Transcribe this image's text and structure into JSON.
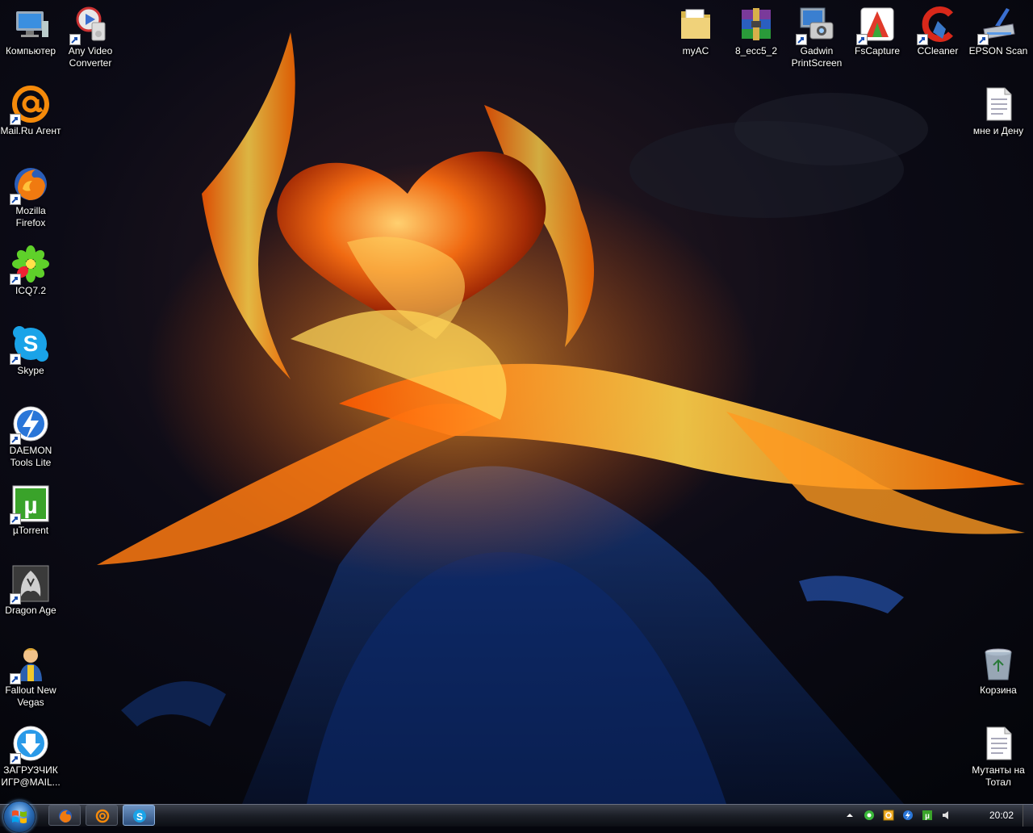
{
  "desktop": {
    "left_icons": [
      {
        "name": "computer-icon",
        "label": "Компьютер"
      },
      {
        "name": "any-video-converter-icon",
        "label": "Any Video Converter"
      },
      {
        "name": "mail-ru-agent-icon",
        "label": "Mail.Ru Агент"
      },
      {
        "name": "mozilla-firefox-icon",
        "label": "Mozilla Firefox"
      },
      {
        "name": "icq-icon",
        "label": "ICQ7.2"
      },
      {
        "name": "skype-icon",
        "label": "Skype"
      },
      {
        "name": "daemon-tools-icon",
        "label": "DAEMON Tools Lite"
      },
      {
        "name": "utorrent-icon",
        "label": "µTorrent"
      },
      {
        "name": "dragon-age-icon",
        "label": "Dragon Age"
      },
      {
        "name": "fallout-new-vegas-icon",
        "label": "Fallout New Vegas"
      },
      {
        "name": "game-loader-icon",
        "label": "ЗАГРУЗЧИК ИГР@MAIL..."
      }
    ],
    "right_icons": [
      {
        "name": "folder-icon",
        "label": "myAC"
      },
      {
        "name": "winrar-archive-icon",
        "label": "8_ecc5_2"
      },
      {
        "name": "gadwin-printscreen-icon",
        "label": "Gadwin PrintScreen"
      },
      {
        "name": "fscapture-icon",
        "label": "FsCapture"
      },
      {
        "name": "ccleaner-icon",
        "label": "CCleaner"
      },
      {
        "name": "epson-scan-icon",
        "label": "EPSON Scan"
      },
      {
        "name": "text-document-icon",
        "label": "мне и Дену"
      },
      {
        "name": "recycle-bin-icon",
        "label": "Корзина"
      },
      {
        "name": "text-document-icon",
        "label": "Мутанты на Тотал"
      }
    ]
  },
  "taskbar": {
    "start_icon": "windows-logo-icon",
    "pinned": [
      {
        "name": "firefox-taskbar-icon",
        "active": false
      },
      {
        "name": "mail-agent-taskbar-icon",
        "active": false
      },
      {
        "name": "skype-taskbar-icon",
        "active": true
      }
    ],
    "tray_icons": [
      "show-hidden-icons-chevron",
      "icq-tray-icon",
      "mail-agent-tray-icon",
      "daemon-tray-icon",
      "utorrent-tray-icon",
      "volume-icon"
    ],
    "clock": "20:02"
  },
  "colors": {
    "taskbar_bg": "#1c1f27",
    "flame": "#ff8a1a",
    "water": "#1d4fa8"
  }
}
